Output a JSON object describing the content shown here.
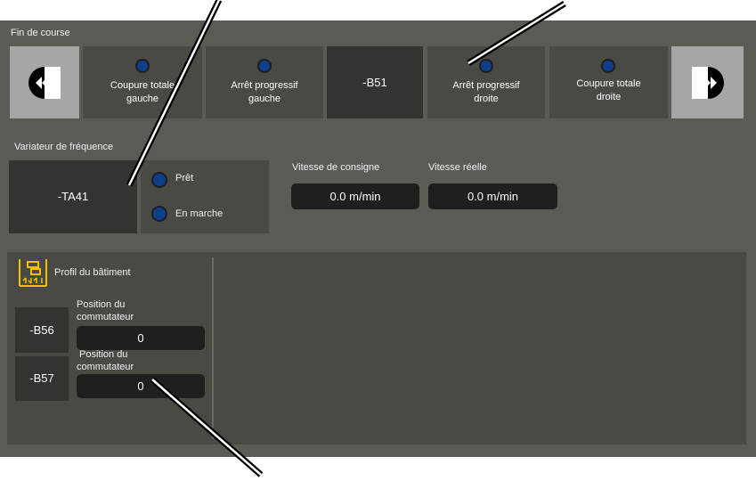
{
  "limit_switch": {
    "title": "Fin de course",
    "left_cut": {
      "line1": "Coupure totale",
      "line2": "gauche"
    },
    "left_progressive": {
      "line1": "Arrêt progressif",
      "line2": "gauche"
    },
    "device": "-B51",
    "right_progressive": {
      "line1": "Arrêt progressif",
      "line2": "droite"
    },
    "right_cut": {
      "line1": "Coupure totale",
      "line2": "droite"
    },
    "prev_icon": "rewind-icon",
    "next_icon": "fast-forward-icon"
  },
  "vfd": {
    "title": "Variateur de fréquence",
    "device": "-TA41",
    "ready": "Prêt",
    "running": "En marche",
    "setpoint_label": "Vitesse de consigne",
    "setpoint_value": "0.0 m/min",
    "actual_label": "Vitesse réelle",
    "actual_value": "0.0 m/min"
  },
  "building_profile": {
    "title": "Profil du bâtiment",
    "icon": "switch-profile-icon",
    "rows": [
      {
        "device": "-B56",
        "label_line1": "Position du",
        "label_line2": "commutateur",
        "value": "0"
      },
      {
        "device": "-B57",
        "label_line1": "Position du",
        "label_line2": "commutateur",
        "value": "0"
      }
    ]
  },
  "colors": {
    "panel_bg": "#5b5b56",
    "tile_bg": "#4a4a45",
    "dark_tile": "#333330",
    "nav_button": "#a6a6a6",
    "led_blue": "#0d3f8a",
    "accent_yellow": "#f2c200"
  }
}
